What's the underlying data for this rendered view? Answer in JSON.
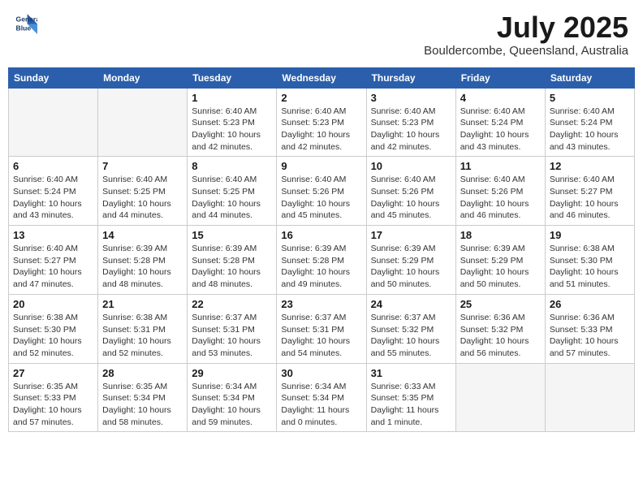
{
  "logo": {
    "line1": "General",
    "line2": "Blue"
  },
  "title": {
    "month_year": "July 2025",
    "location": "Bouldercombe, Queensland, Australia"
  },
  "weekdays": [
    "Sunday",
    "Monday",
    "Tuesday",
    "Wednesday",
    "Thursday",
    "Friday",
    "Saturday"
  ],
  "weeks": [
    [
      {
        "day": "",
        "info": ""
      },
      {
        "day": "",
        "info": ""
      },
      {
        "day": "1",
        "info": "Sunrise: 6:40 AM\nSunset: 5:23 PM\nDaylight: 10 hours and 42 minutes."
      },
      {
        "day": "2",
        "info": "Sunrise: 6:40 AM\nSunset: 5:23 PM\nDaylight: 10 hours and 42 minutes."
      },
      {
        "day": "3",
        "info": "Sunrise: 6:40 AM\nSunset: 5:23 PM\nDaylight: 10 hours and 42 minutes."
      },
      {
        "day": "4",
        "info": "Sunrise: 6:40 AM\nSunset: 5:24 PM\nDaylight: 10 hours and 43 minutes."
      },
      {
        "day": "5",
        "info": "Sunrise: 6:40 AM\nSunset: 5:24 PM\nDaylight: 10 hours and 43 minutes."
      }
    ],
    [
      {
        "day": "6",
        "info": "Sunrise: 6:40 AM\nSunset: 5:24 PM\nDaylight: 10 hours and 43 minutes."
      },
      {
        "day": "7",
        "info": "Sunrise: 6:40 AM\nSunset: 5:25 PM\nDaylight: 10 hours and 44 minutes."
      },
      {
        "day": "8",
        "info": "Sunrise: 6:40 AM\nSunset: 5:25 PM\nDaylight: 10 hours and 44 minutes."
      },
      {
        "day": "9",
        "info": "Sunrise: 6:40 AM\nSunset: 5:26 PM\nDaylight: 10 hours and 45 minutes."
      },
      {
        "day": "10",
        "info": "Sunrise: 6:40 AM\nSunset: 5:26 PM\nDaylight: 10 hours and 45 minutes."
      },
      {
        "day": "11",
        "info": "Sunrise: 6:40 AM\nSunset: 5:26 PM\nDaylight: 10 hours and 46 minutes."
      },
      {
        "day": "12",
        "info": "Sunrise: 6:40 AM\nSunset: 5:27 PM\nDaylight: 10 hours and 46 minutes."
      }
    ],
    [
      {
        "day": "13",
        "info": "Sunrise: 6:40 AM\nSunset: 5:27 PM\nDaylight: 10 hours and 47 minutes."
      },
      {
        "day": "14",
        "info": "Sunrise: 6:39 AM\nSunset: 5:28 PM\nDaylight: 10 hours and 48 minutes."
      },
      {
        "day": "15",
        "info": "Sunrise: 6:39 AM\nSunset: 5:28 PM\nDaylight: 10 hours and 48 minutes."
      },
      {
        "day": "16",
        "info": "Sunrise: 6:39 AM\nSunset: 5:28 PM\nDaylight: 10 hours and 49 minutes."
      },
      {
        "day": "17",
        "info": "Sunrise: 6:39 AM\nSunset: 5:29 PM\nDaylight: 10 hours and 50 minutes."
      },
      {
        "day": "18",
        "info": "Sunrise: 6:39 AM\nSunset: 5:29 PM\nDaylight: 10 hours and 50 minutes."
      },
      {
        "day": "19",
        "info": "Sunrise: 6:38 AM\nSunset: 5:30 PM\nDaylight: 10 hours and 51 minutes."
      }
    ],
    [
      {
        "day": "20",
        "info": "Sunrise: 6:38 AM\nSunset: 5:30 PM\nDaylight: 10 hours and 52 minutes."
      },
      {
        "day": "21",
        "info": "Sunrise: 6:38 AM\nSunset: 5:31 PM\nDaylight: 10 hours and 52 minutes."
      },
      {
        "day": "22",
        "info": "Sunrise: 6:37 AM\nSunset: 5:31 PM\nDaylight: 10 hours and 53 minutes."
      },
      {
        "day": "23",
        "info": "Sunrise: 6:37 AM\nSunset: 5:31 PM\nDaylight: 10 hours and 54 minutes."
      },
      {
        "day": "24",
        "info": "Sunrise: 6:37 AM\nSunset: 5:32 PM\nDaylight: 10 hours and 55 minutes."
      },
      {
        "day": "25",
        "info": "Sunrise: 6:36 AM\nSunset: 5:32 PM\nDaylight: 10 hours and 56 minutes."
      },
      {
        "day": "26",
        "info": "Sunrise: 6:36 AM\nSunset: 5:33 PM\nDaylight: 10 hours and 57 minutes."
      }
    ],
    [
      {
        "day": "27",
        "info": "Sunrise: 6:35 AM\nSunset: 5:33 PM\nDaylight: 10 hours and 57 minutes."
      },
      {
        "day": "28",
        "info": "Sunrise: 6:35 AM\nSunset: 5:34 PM\nDaylight: 10 hours and 58 minutes."
      },
      {
        "day": "29",
        "info": "Sunrise: 6:34 AM\nSunset: 5:34 PM\nDaylight: 10 hours and 59 minutes."
      },
      {
        "day": "30",
        "info": "Sunrise: 6:34 AM\nSunset: 5:34 PM\nDaylight: 11 hours and 0 minutes."
      },
      {
        "day": "31",
        "info": "Sunrise: 6:33 AM\nSunset: 5:35 PM\nDaylight: 11 hours and 1 minute."
      },
      {
        "day": "",
        "info": ""
      },
      {
        "day": "",
        "info": ""
      }
    ]
  ]
}
